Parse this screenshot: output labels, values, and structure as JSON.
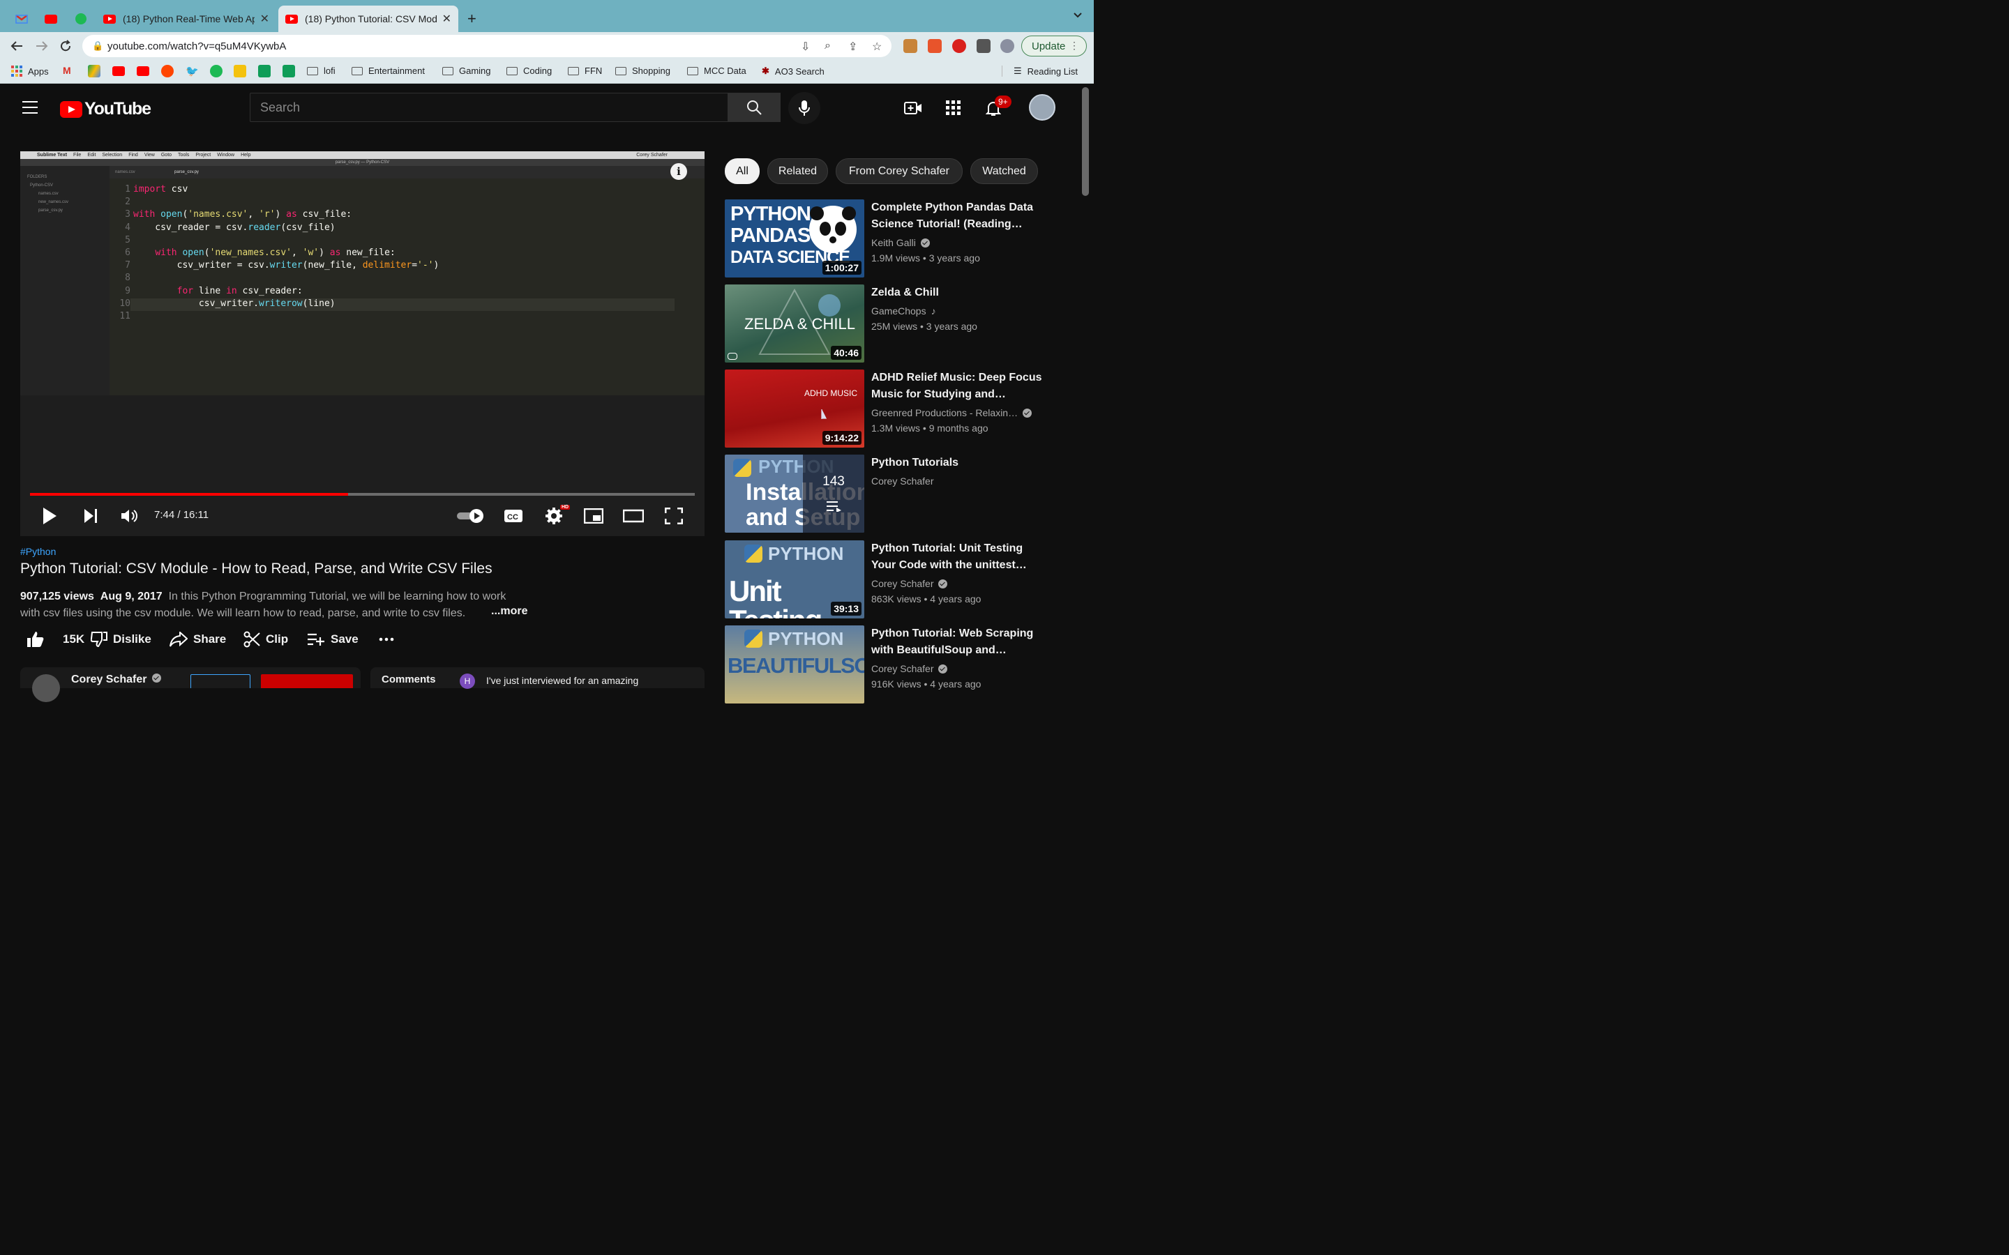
{
  "browser": {
    "tabs": [
      {
        "title": "(18) Python Real-Time Web Ap"
      },
      {
        "title": "(18) Python Tutorial: CSV Modu"
      }
    ],
    "url": "youtube.com/watch?v=q5uM4VKywbA",
    "update_label": "Update",
    "bookmarks": [
      "Apps",
      "lofi",
      "Entertainment",
      "Gaming",
      "Coding",
      "FFN",
      "Shopping",
      "MCC Data",
      "AO3 Search"
    ],
    "reading_list": "Reading List"
  },
  "youtube": {
    "logo_text": "YouTube",
    "search_placeholder": "Search",
    "notification_count": "9+"
  },
  "player": {
    "time": "7:44 / 16:11",
    "progress_fraction": 0.478,
    "hd_label": "HD",
    "editor": {
      "app_menu": [
        "Sublime Text",
        "File",
        "Edit",
        "Selection",
        "Find",
        "View",
        "Goto",
        "Tools",
        "Project",
        "Window",
        "Help"
      ],
      "owner": "Corey Schafer",
      "window_title": "parse_csv.py — Python-CSV",
      "folders_label": "FOLDERS",
      "tree": [
        "Python-CSV",
        "names.csv",
        "new_names.csv",
        "parse_csv.py"
      ],
      "tabs": [
        "names.csv",
        "parse_csv.py"
      ]
    }
  },
  "video": {
    "hashtag": "#Python",
    "title": "Python Tutorial: CSV Module - How to Read, Parse, and Write CSV Files",
    "views": "907,125 views",
    "date": "Aug 9, 2017",
    "description_line1": "In this Python Programming Tutorial, we will be learning how to work",
    "description_line2": "with csv files using the csv module. We will learn how to read, parse, and write to csv files.",
    "more_label": "...more",
    "likes": "15K",
    "dislike_label": "Dislike",
    "share_label": "Share",
    "clip_label": "Clip",
    "save_label": "Save",
    "channel": "Corey Schafer",
    "comments_label": "Comments",
    "comment_avatar": "H",
    "comment_preview": "I've just interviewed for an amazing"
  },
  "chips": [
    "All",
    "Related",
    "From Corey Schafer",
    "Watched"
  ],
  "recommendations": [
    {
      "title": "Complete Python Pandas Data Science Tutorial! (Reading…",
      "channel": "Keith Galli",
      "meta": "1.9M views • 3 years ago",
      "duration": "1:00:27",
      "thumb_text": [
        "PYTHON",
        "PANDAS",
        "DATA SCIENCE"
      ]
    },
    {
      "title": "Zelda & Chill",
      "channel": "GameChops",
      "meta": "25M views • 3 years ago",
      "duration": "40:46",
      "thumb_text": [
        "ZELDA & CHILL"
      ]
    },
    {
      "title": "ADHD Relief Music: Deep Focus Music for Studying and…",
      "channel": "Greenred Productions - Relaxin…",
      "meta": "1.3M views • 9 months ago",
      "duration": "9:14:22",
      "thumb_text": [
        "ADHD MUSIC"
      ]
    },
    {
      "title": "Python Tutorials",
      "channel": "Corey Schafer",
      "meta": "",
      "playlist_count": "143",
      "thumb_text": [
        "PYTHON",
        "Installation",
        "and Setup"
      ]
    },
    {
      "title": "Python Tutorial: Unit Testing Your Code with the unittest…",
      "channel": "Corey Schafer",
      "meta": "863K views • 4 years ago",
      "duration": "39:13",
      "thumb_text": [
        "PYTHON",
        "Unit Testing"
      ]
    },
    {
      "title": "Python Tutorial: Web Scraping with BeautifulSoup and…",
      "channel": "Corey Schafer",
      "meta": "916K views • 4 years ago",
      "thumb_text": [
        "PYTHON",
        "BEAUTIFULSOUP"
      ]
    }
  ]
}
